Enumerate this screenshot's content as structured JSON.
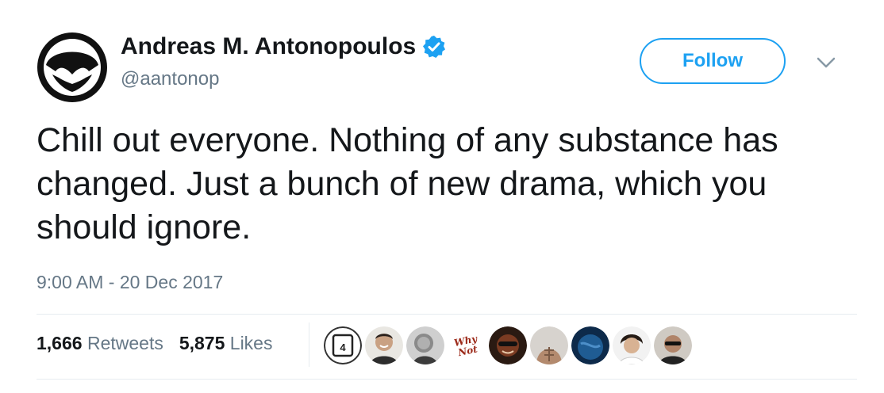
{
  "author": {
    "name": "Andreas M. Antonopoulos",
    "handle": "@aantonop",
    "verified": true
  },
  "actions": {
    "follow_label": "Follow"
  },
  "tweet": {
    "text": "Chill out everyone. Nothing of any substance has changed. Just a bunch of new drama, which you should ignore.",
    "timestamp": "9:00 AM - 20 Dec 2017"
  },
  "stats": {
    "retweets_count": "1,666",
    "retweets_label": "Retweets",
    "likes_count": "5,875",
    "likes_label": "Likes"
  },
  "likers": [
    {
      "icon": "b4-logo-avatar"
    },
    {
      "icon": "smiling-man-avatar"
    },
    {
      "icon": "man-portrait-avatar"
    },
    {
      "icon": "whys-not-logo-avatar"
    },
    {
      "icon": "dark-face-avatar"
    },
    {
      "icon": "muscle-torso-avatar"
    },
    {
      "icon": "blue-planet-avatar"
    },
    {
      "icon": "curly-hair-man-avatar"
    },
    {
      "icon": "sunglasses-man-avatar"
    }
  ],
  "colors": {
    "accent": "#1da1f2",
    "text": "#14171a",
    "secondary": "#657786",
    "divider": "#e6ecf0"
  }
}
